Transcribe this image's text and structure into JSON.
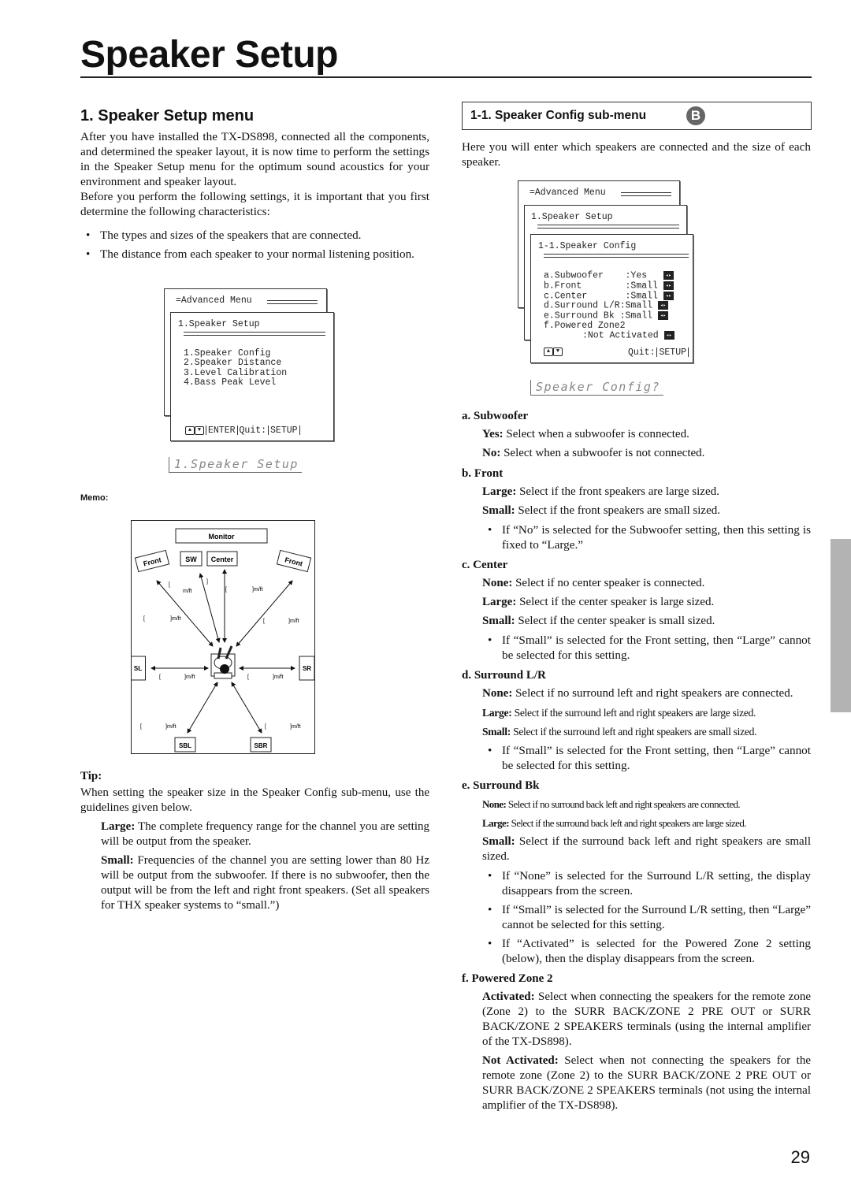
{
  "page": {
    "title": "Speaker Setup",
    "page_number": "29",
    "side_tab_color": "#b3b3b3"
  },
  "left": {
    "section_heading": "1. Speaker Setup menu",
    "intro_p1": "After you have installed the TX-DS898, connected all the components, and determined the speaker layout, it is now time to perform the settings in the Speaker Setup menu for the optimum sound acoustics for your environment and speaker layout.",
    "intro_p2": "Before you perform the following settings, it is important that you first determine the following characteristics:",
    "bullets": [
      "The types and sizes of the speakers that are connected.",
      "The distance from each speaker to your normal listening position."
    ],
    "osd": {
      "back_title": "Advanced Menu",
      "front_title": "1.Speaker Setup",
      "items": [
        "1.Speaker Config",
        "2.Speaker Distance",
        "3.Level Calibration",
        "4.Bass Peak Level"
      ],
      "footer_enter": "ENTER",
      "footer_quit": "Quit:",
      "footer_setup": "SETUP",
      "lcd": "1.Speaker Setup"
    },
    "memo_label": "Memo:",
    "diagram": {
      "monitor": "Monitor",
      "sw": "SW",
      "center": "Center",
      "front_left": "Front",
      "front_right": "Front",
      "sl": "SL",
      "sr": "SR",
      "sbl": "SBL",
      "sbr": "SBR",
      "unit": "]m/ft",
      "bracket": "["
    },
    "tip": {
      "heading": "Tip:",
      "intro": "When setting the speaker size in the Speaker Config sub-menu, use the guidelines given below.",
      "large_label": "Large:",
      "large_text": " The complete frequency range for the channel you are setting will be output from the speaker.",
      "small_label": "Small:",
      "small_text": " Frequencies of the channel you are setting lower than 80 Hz will be output from the subwoofer. If there is no subwoofer, then the output will be from the left and right front speakers. (Set all speakers for THX speaker systems to “small.”)"
    }
  },
  "right": {
    "submenu_heading": "1-1. Speaker Config sub-menu",
    "submenu_badge": "B",
    "intro": "Here you will enter which speakers are connected and the size of each speaker.",
    "osd": {
      "back_title": "Advanced Menu",
      "mid_title": "1.Speaker Setup",
      "front_title": "1-1.Speaker Config",
      "rows": [
        {
          "label": "a.Subwoofer    ",
          "value": ":Yes  "
        },
        {
          "label": "b.Front        ",
          "value": ":Small"
        },
        {
          "label": "c.Center       ",
          "value": ":Small"
        },
        {
          "label": "d.Surround L/R",
          "value": ":Small"
        },
        {
          "label": "e.Surround Bk ",
          "value": ":Small"
        }
      ],
      "zone_label": "f.Powered Zone2",
      "zone_value": ":Not Activated",
      "footer_quit": "Quit:",
      "footer_setup": "SETUP",
      "lcd": "Speaker Config?"
    },
    "sections": [
      {
        "heading": "a. Subwoofer",
        "options": [
          {
            "label": "Yes:",
            "text": " Select when a subwoofer is connected."
          },
          {
            "label": "No:",
            "text": " Select when a subwoofer is not connected."
          }
        ],
        "notes": []
      },
      {
        "heading": "b. Front",
        "options": [
          {
            "label": "Large:",
            "text": " Select if the front speakers are large sized."
          },
          {
            "label": "Small:",
            "text": " Select if the front speakers are small sized."
          }
        ],
        "notes": [
          "If “No” is selected for the Subwoofer setting, then this setting is fixed to “Large.”"
        ]
      },
      {
        "heading": "c. Center",
        "options": [
          {
            "label": "None:",
            "text": " Select if no center speaker is connected."
          },
          {
            "label": "Large:",
            "text": " Select if the center speaker is large sized."
          },
          {
            "label": "Small:",
            "text": " Select if the center speaker is small sized."
          }
        ],
        "notes": [
          "If “Small” is selected for the Front setting, then “Large” cannot be selected for this setting."
        ]
      },
      {
        "heading": "d. Surround L/R",
        "options": [
          {
            "label": "None:",
            "text": " Select if no surround left and right speakers are connected."
          },
          {
            "label": "Large:",
            "text": " Select if the surround left and right speakers are large sized."
          },
          {
            "label": "Small:",
            "text": " Select if the surround left and right speakers are small sized."
          }
        ],
        "notes": [
          "If “Small” is selected for the Front setting, then “Large” cannot be selected for this setting."
        ]
      },
      {
        "heading": "e. Surround Bk",
        "options": [
          {
            "label": "None:",
            "text": " Select if no surround back left and right speakers are connected."
          },
          {
            "label": "Large:",
            "text": " Select if the surround back left and right speakers are large sized."
          },
          {
            "label": "Small:",
            "text": " Select if the surround back left and right speakers are small sized."
          }
        ],
        "notes": [
          "If “None” is selected for the Surround L/R setting, the display disappears from the screen.",
          "If “Small” is selected for the Surround L/R setting, then “Large” cannot be selected for this setting.",
          "If “Activated” is selected for the Powered Zone 2 setting (below), then the display disappears from the screen."
        ]
      },
      {
        "heading": "f. Powered Zone 2",
        "options": [
          {
            "label": "Activated:",
            "text": " Select when connecting the speakers for the remote zone (Zone 2) to the SURR BACK/ZONE 2 PRE OUT or SURR BACK/ZONE 2 SPEAKERS terminals (using the internal amplifier of the TX-DS898)."
          },
          {
            "label": "Not Activated:",
            "text": " Select when not connecting the speakers for the remote zone (Zone 2) to the SURR BACK/ZONE 2 PRE OUT or SURR BACK/ZONE 2 SPEAKERS terminals (not using the internal amplifier of the TX-DS898)."
          }
        ],
        "notes": []
      }
    ]
  }
}
